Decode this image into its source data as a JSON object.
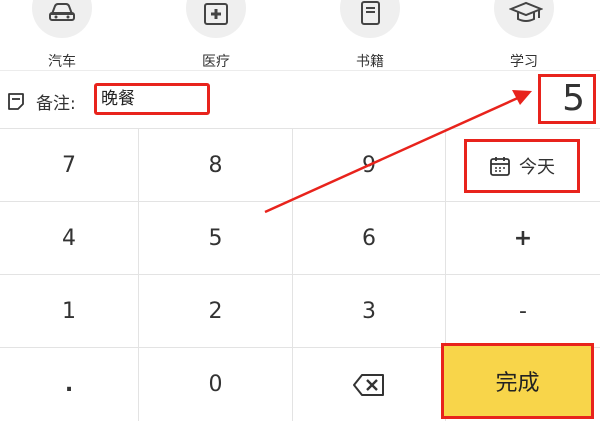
{
  "categories": [
    {
      "label": "汽车",
      "icon": "car-icon"
    },
    {
      "label": "医疗",
      "icon": "medical-kit-icon"
    },
    {
      "label": "书籍",
      "icon": "book-icon"
    },
    {
      "label": "学习",
      "icon": "graduation-cap-icon"
    }
  ],
  "note": {
    "prefix": "备注:",
    "value": "晚餐",
    "icon": "note-icon"
  },
  "amount": "5",
  "keypad": {
    "row1": [
      "7",
      "8",
      "9"
    ],
    "row2": [
      "4",
      "5",
      "6",
      "+"
    ],
    "row3": [
      "1",
      "2",
      "3",
      "-"
    ],
    "row4": [
      ".",
      "0"
    ],
    "today_label": "今天",
    "done_label": "完成",
    "backspace_icon": "backspace-icon",
    "calendar_icon": "calendar-icon"
  },
  "colors": {
    "highlight": "#e8231c",
    "done_bg": "#f8d54a",
    "divider": "#e3e3e3"
  }
}
